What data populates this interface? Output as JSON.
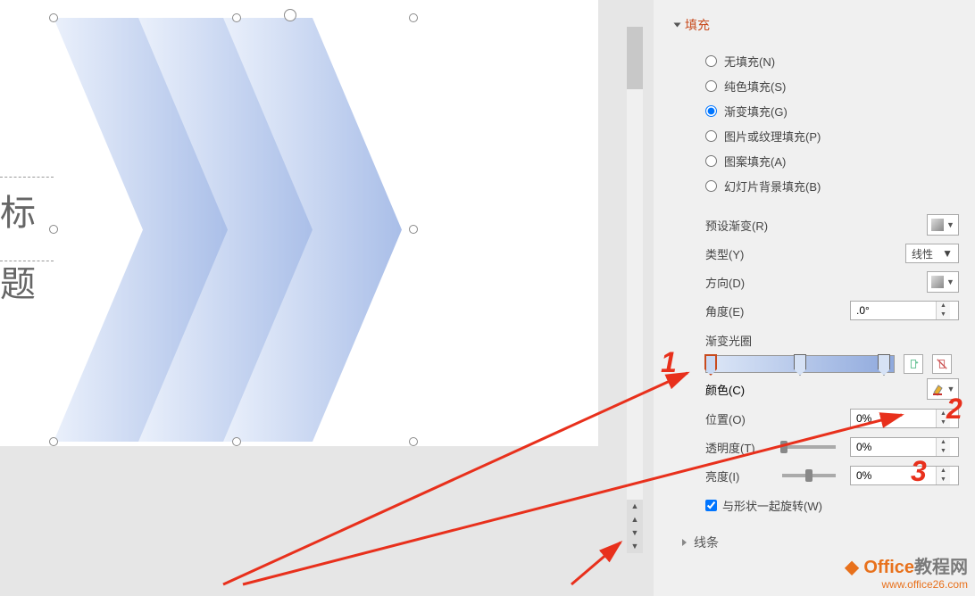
{
  "panel": {
    "fill_header": "填充",
    "radios": {
      "no_fill": "无填充(N)",
      "solid": "纯色填充(S)",
      "gradient": "渐变填充(G)",
      "picture": "图片或纹理填充(P)",
      "pattern": "图案填充(A)",
      "slidebg": "幻灯片背景填充(B)"
    },
    "preset": "预设渐变(R)",
    "type_label": "类型(Y)",
    "type_value": "线性",
    "direction": "方向(D)",
    "angle_label": "角度(E)",
    "angle_value": ".0°",
    "stops_label": "渐变光圈",
    "color_label": "颜色(C)",
    "position_label": "位置(O)",
    "position_value": "0%",
    "transparency_label": "透明度(T)",
    "transparency_value": "0%",
    "brightness_label": "亮度(I)",
    "brightness_value": "0%",
    "rotate_label": "与形状一起旋转(W)",
    "line_header": "线条"
  },
  "title_placeholder": "标题",
  "annotations": {
    "one": "1",
    "two": "2",
    "three": "3"
  },
  "watermark": {
    "brand1": "Office",
    "brand2": "教程网",
    "url": "www.office26.com"
  }
}
